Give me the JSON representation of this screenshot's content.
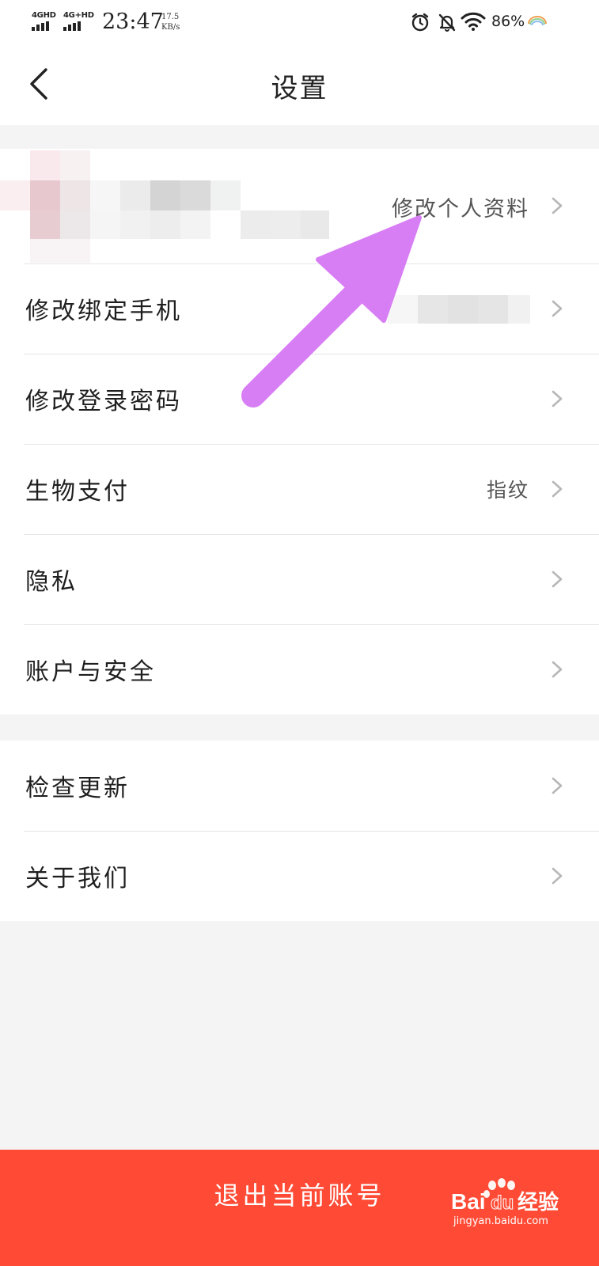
{
  "status_bar": {
    "signal_1": "4GHD",
    "signal_2": "4G+HD",
    "time": "23:47",
    "speed_value": "17.5",
    "speed_unit": "KB/s",
    "battery": "86%"
  },
  "header": {
    "title": "设置"
  },
  "profile": {
    "link_label": "修改个人资料"
  },
  "settings_group_1": [
    {
      "label": "修改绑定手机",
      "value": ""
    },
    {
      "label": "修改登录密码",
      "value": ""
    },
    {
      "label": "生物支付",
      "value": "指纹"
    },
    {
      "label": "隐私",
      "value": ""
    },
    {
      "label": "账户与安全",
      "value": ""
    }
  ],
  "settings_group_2": [
    {
      "label": "检查更新"
    },
    {
      "label": "关于我们"
    }
  ],
  "logout": {
    "label": "退出当前账号"
  },
  "watermark": {
    "brand": "Baidu经验",
    "url": "jingyan.baidu.com"
  },
  "colors": {
    "accent": "#ff4b35",
    "annotation_arrow": "#d87ef5",
    "background": "#f4f4f5"
  }
}
